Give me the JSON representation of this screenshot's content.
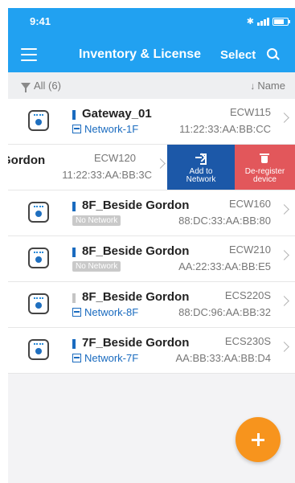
{
  "status_bar": {
    "time": "9:41",
    "bluetooth": "bluetooth-icon",
    "signal": "signal-icon",
    "battery": "battery-icon"
  },
  "header": {
    "title": "Inventory & License",
    "select_label": "Select"
  },
  "filter": {
    "label": "All (6)",
    "sort_label": "Name",
    "sort_arrow": "↓"
  },
  "devices": [
    {
      "name": "Gateway_01",
      "network": "Network-1F",
      "model": "ECW115",
      "mac": "11:22:33:AA:BB:CC",
      "status": "active"
    },
    {
      "name": "Gordon",
      "network": "",
      "model": "ECW120",
      "mac": "11:22:33:AA:BB:3C",
      "status": "swiped"
    },
    {
      "name": "8F_Beside Gordon",
      "network": "No Network",
      "model": "ECW160",
      "mac": "88:DC:33:AA:BB:80",
      "status": "active"
    },
    {
      "name": "8F_Beside Gordon",
      "network": "No Network",
      "model": "ECW210",
      "mac": "AA:22:33:AA:BB:E5",
      "status": "active"
    },
    {
      "name": "8F_Beside Gordon",
      "network": "Network-8F",
      "model": "ECS220S",
      "mac": "88:DC:96:AA:BB:32",
      "status": "inactive"
    },
    {
      "name": "7F_Beside Gordon",
      "network": "Network-7F",
      "model": "ECS230S",
      "mac": "AA:BB:33:AA:BB:D4",
      "status": "active"
    }
  ],
  "swipe_actions": {
    "add_line1": "Add to",
    "add_line2": "Network",
    "remove_line1": "De-register",
    "remove_line2": "device"
  },
  "colors": {
    "primary": "#21a1f1",
    "accent": "#f7941d",
    "add_action": "#1c58a8",
    "remove_action": "#e2575b"
  }
}
